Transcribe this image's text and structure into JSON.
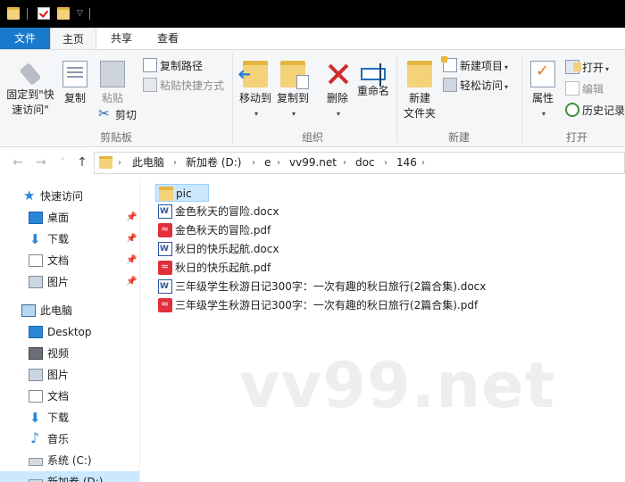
{
  "titlebar": {
    "icons": [
      "folder-icon",
      "properties-icon",
      "new-folder-icon",
      "customize-dropdown-icon"
    ]
  },
  "tabs": [
    {
      "label": "文件"
    },
    {
      "label": "主页"
    },
    {
      "label": "共享"
    },
    {
      "label": "查看"
    }
  ],
  "ribbon": {
    "clipboard": {
      "pin_label": "固定到\"快\n速访问\"",
      "copy_label": "复制",
      "paste_label": "粘贴",
      "copy_path_label": "复制路径",
      "paste_shortcut_label": "粘贴快捷方式",
      "cut_label": "剪切",
      "group_label": "剪贴板"
    },
    "organize": {
      "move_to_label": "移动到",
      "copy_to_label": "复制到",
      "delete_label": "删除",
      "rename_label": "重命名",
      "group_label": "组织"
    },
    "new": {
      "new_folder_label": "新建\n文件夹",
      "new_item_label": "新建项目",
      "easy_access_label": "轻松访问",
      "group_label": "新建"
    },
    "open": {
      "properties_label": "属性",
      "open_label": "打开",
      "edit_label": "编辑",
      "history_label": "历史记录",
      "group_label": "打开"
    }
  },
  "address": {
    "crumbs": [
      "此电脑",
      "新加卷 (D:)",
      "e",
      "vv99.net",
      "doc",
      "146"
    ]
  },
  "navpane": {
    "items": [
      {
        "label": "快速访问",
        "icon": "star-icon"
      },
      {
        "label": "桌面",
        "icon": "desktop-icon",
        "pinned": true
      },
      {
        "label": "下载",
        "icon": "download-icon",
        "pinned": true
      },
      {
        "label": "文档",
        "icon": "documents-icon",
        "pinned": true
      },
      {
        "label": "图片",
        "icon": "pictures-icon",
        "pinned": true
      },
      {
        "label": "此电脑",
        "icon": "this-pc-icon"
      },
      {
        "label": "Desktop",
        "icon": "desktop-icon"
      },
      {
        "label": "视频",
        "icon": "videos-icon"
      },
      {
        "label": "图片",
        "icon": "pictures-icon"
      },
      {
        "label": "文档",
        "icon": "documents-icon"
      },
      {
        "label": "下载",
        "icon": "download-icon"
      },
      {
        "label": "音乐",
        "icon": "music-icon"
      },
      {
        "label": "系统 (C:)",
        "icon": "drive-icon"
      },
      {
        "label": "新加卷 (D:)",
        "icon": "drive-icon"
      }
    ]
  },
  "files": [
    {
      "name": "pic",
      "type": "folder",
      "icon": "folder-icon"
    },
    {
      "name": "金色秋天的冒险.docx",
      "type": "docx",
      "icon": "word-icon"
    },
    {
      "name": "金色秋天的冒险.pdf",
      "type": "pdf",
      "icon": "pdf-icon"
    },
    {
      "name": "秋日的快乐起航.docx",
      "type": "docx",
      "icon": "word-icon"
    },
    {
      "name": "秋日的快乐起航.pdf",
      "type": "pdf",
      "icon": "pdf-icon"
    },
    {
      "name": "三年级学生秋游日记300字：一次有趣的秋日旅行(2篇合集).docx",
      "type": "docx",
      "icon": "word-icon"
    },
    {
      "name": "三年级学生秋游日记300字：一次有趣的秋日旅行(2篇合集).pdf",
      "type": "pdf",
      "icon": "pdf-icon"
    }
  ],
  "watermark": "vv99.net",
  "colors": {
    "file_tab": "#1979ca",
    "selection": "#cce8ff",
    "ribbon_bg": "#f5f6f7",
    "titlebar_bg": "#000000"
  }
}
